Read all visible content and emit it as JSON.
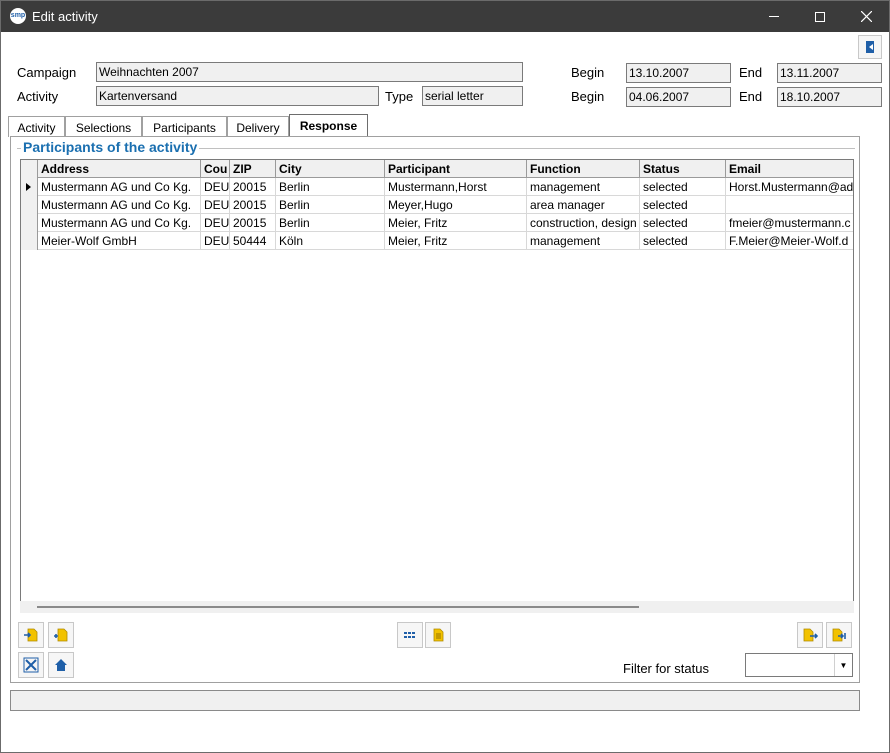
{
  "window": {
    "title": "Edit activity",
    "icon_text": "smp"
  },
  "header": {
    "campaign_label": "Campaign",
    "campaign_value": "Weihnachten 2007",
    "activity_label": "Activity",
    "activity_value": "Kartenversand",
    "type_label": "Type",
    "type_value": "serial letter",
    "begin_label": "Begin",
    "end_label": "End",
    "campaign_begin": "13.10.2007",
    "campaign_end": "13.11.2007",
    "activity_begin": "04.06.2007",
    "activity_end": "18.10.2007"
  },
  "tabs": [
    {
      "label": "Activity"
    },
    {
      "label": "Selections"
    },
    {
      "label": "Participants"
    },
    {
      "label": "Delivery"
    },
    {
      "label": "Response",
      "active": true
    }
  ],
  "group": {
    "title": "Participants of the activity"
  },
  "grid": {
    "columns": [
      "Address",
      "Cou",
      "ZIP",
      "City",
      "Participant",
      "Function",
      "Status",
      "Email"
    ],
    "rows": [
      [
        "Mustermann AG und Co Kg.",
        "DEU",
        "20015",
        "Berlin",
        "Mustermann,Horst",
        "management",
        "selected",
        "Horst.Mustermann@ad"
      ],
      [
        "Mustermann AG und Co Kg.",
        "DEU",
        "20015",
        "Berlin",
        "Meyer,Hugo",
        "area manager",
        "selected",
        ""
      ],
      [
        "Mustermann AG und Co Kg.",
        "DEU",
        "20015",
        "Berlin",
        "Meier, Fritz",
        "construction, design",
        "selected",
        "fmeier@mustermann.c"
      ],
      [
        "Meier-Wolf GmbH",
        "DEU",
        "50444",
        "Köln",
        "Meier, Fritz",
        "management",
        "selected",
        "F.Meier@Meier-Wolf.d"
      ]
    ],
    "selected_row": 0
  },
  "filter": {
    "label": "Filter for status",
    "value": ""
  },
  "colors": {
    "accent": "#1a6fb0",
    "titlebar": "#3b3b3b",
    "icon_yellow": "#f2c200",
    "icon_blue": "#1f5fa8"
  }
}
